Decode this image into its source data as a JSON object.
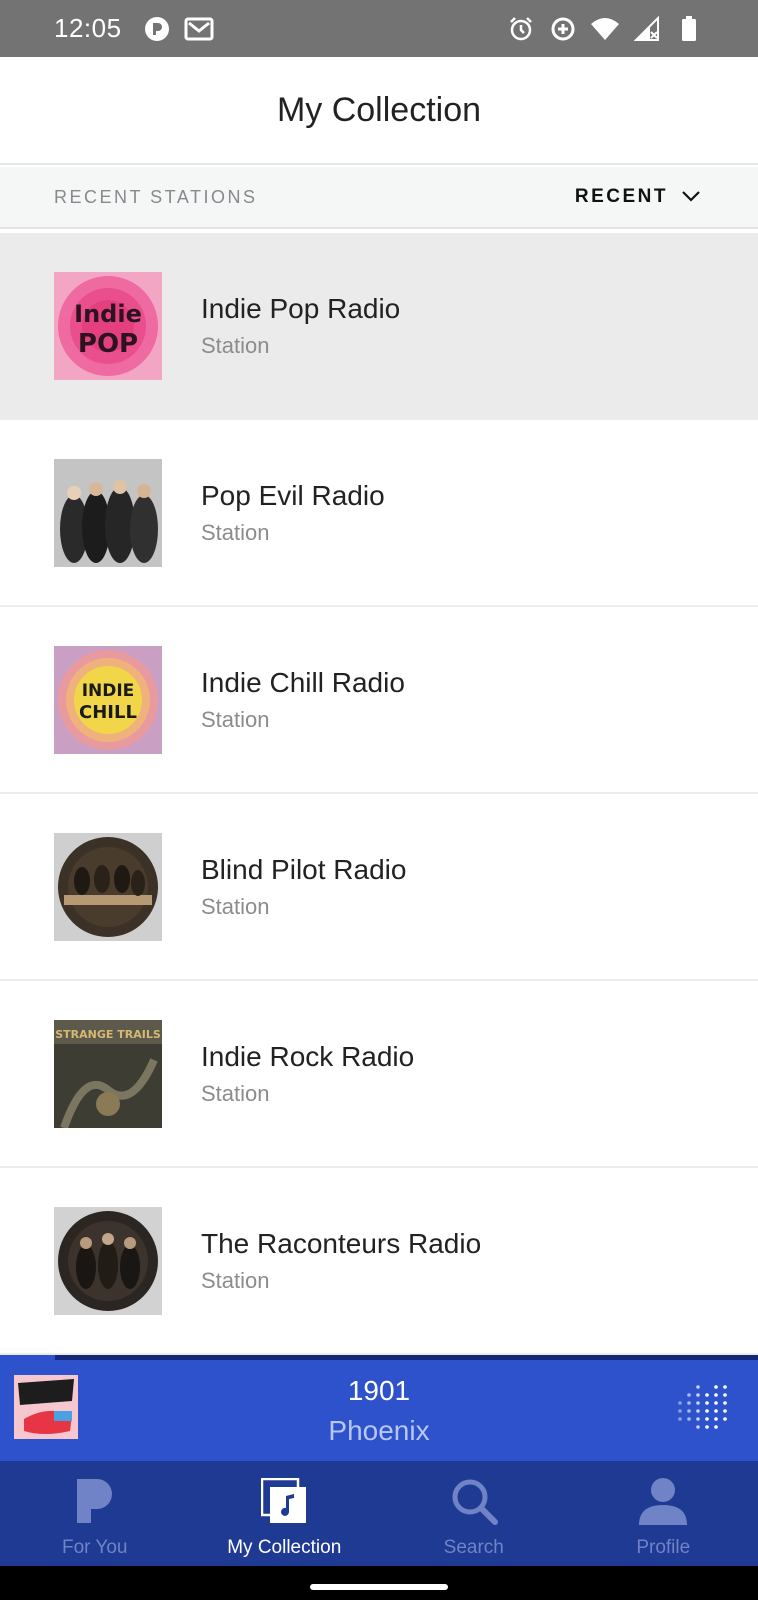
{
  "status_bar": {
    "time": "12:05",
    "left_icons": [
      "pandora-notification-icon",
      "gmail-notification-icon"
    ],
    "right_icons": [
      "alarm-icon",
      "data-saver-icon",
      "wifi-icon",
      "signal-icon",
      "battery-icon"
    ]
  },
  "header": {
    "title": "My Collection"
  },
  "subheader": {
    "section_label": "RECENT STATIONS",
    "sort_label": "RECENT"
  },
  "stations": [
    {
      "name": "Indie Pop Radio",
      "type": "Station",
      "art_text": [
        "Indie",
        "POP"
      ],
      "selected": true
    },
    {
      "name": "Pop Evil Radio",
      "type": "Station",
      "art_text": []
    },
    {
      "name": "Indie Chill Radio",
      "type": "Station",
      "art_text": [
        "INDIE",
        "CHILL"
      ]
    },
    {
      "name": "Blind Pilot Radio",
      "type": "Station",
      "art_text": []
    },
    {
      "name": "Indie Rock Radio",
      "type": "Station",
      "art_text": [
        "STRANGE TRAILS"
      ]
    },
    {
      "name": "The Raconteurs Radio",
      "type": "Station",
      "art_text": []
    }
  ],
  "now_playing": {
    "track": "1901",
    "artist": "Phoenix"
  },
  "tabs": [
    {
      "label": "For You",
      "icon": "pandora-p-icon",
      "active": false
    },
    {
      "label": "My Collection",
      "icon": "collection-icon",
      "active": true
    },
    {
      "label": "Search",
      "icon": "search-icon",
      "active": false
    },
    {
      "label": "Profile",
      "icon": "profile-icon",
      "active": false
    }
  ],
  "colors": {
    "status_bar": "#737373",
    "now_playing_bg": "#2d52cb",
    "tab_bar_bg": "#1f3a92",
    "tab_inactive": "#6f83c6",
    "tab_active": "#ffffff",
    "selected_row": "#ebebeb"
  }
}
